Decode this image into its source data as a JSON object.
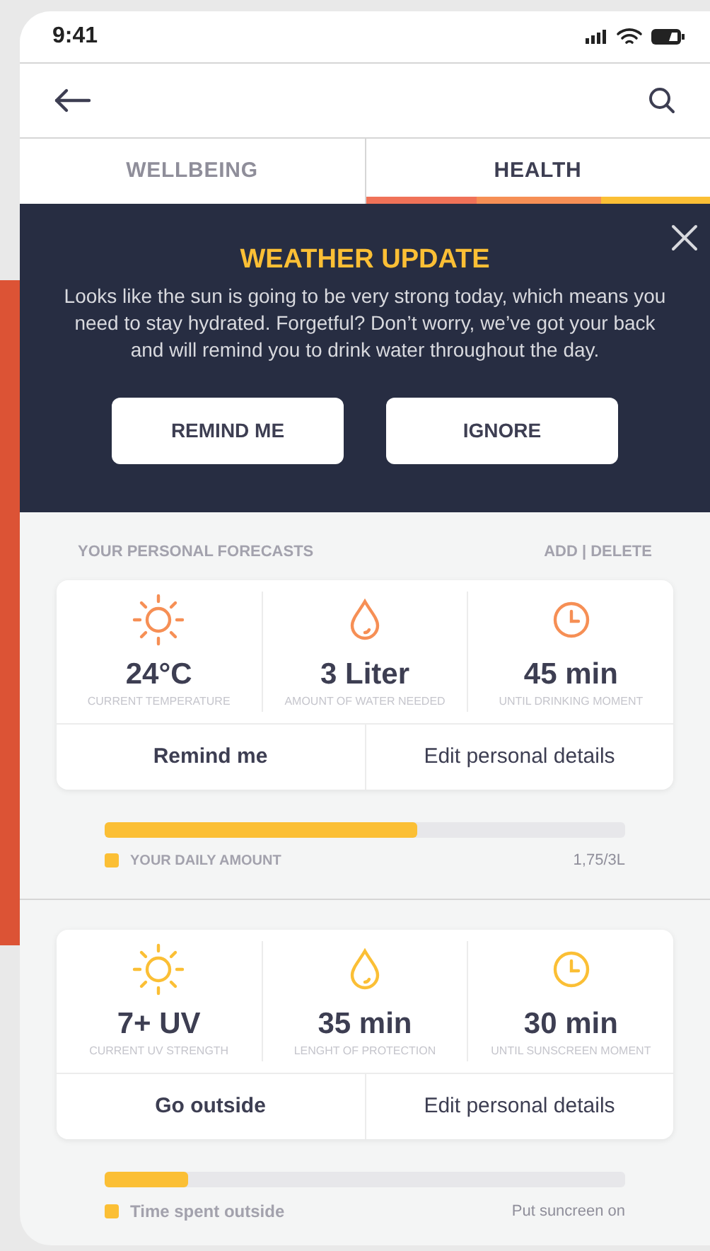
{
  "status_bar": {
    "time": "9:41"
  },
  "tabs": [
    {
      "label": "WELLBEING",
      "selected": false
    },
    {
      "label": "HEALTH",
      "selected": true
    }
  ],
  "banner": {
    "title": "WEATHER UPDATE",
    "message": "Looks like the sun is going to be very strong today, which means you need to stay hydrated. Forgetful? Don’t worry, we’ve got your back and will remind you to drink water throughout the day.",
    "buttons": [
      "REMIND ME",
      "IGNORE"
    ]
  },
  "section": {
    "title": "YOUR PERSONAL FORECASTS",
    "actions": "ADD | DELETE"
  },
  "forecasts": [
    {
      "color": "#f68f55",
      "stats": [
        {
          "kind": "sun",
          "value": "24°C",
          "caption": "CURRENT TEMPERATURE"
        },
        {
          "kind": "drop",
          "value": "3 Liter",
          "caption": "AMOUNT OF WATER NEEDED"
        },
        {
          "kind": "clock",
          "value": "45 min",
          "caption": "UNTIL DRINKING MOMENT"
        }
      ],
      "actions": [
        "Remind me",
        "Edit personal details"
      ],
      "progress": {
        "level": 0.6,
        "label": "YOUR DAILY AMOUNT",
        "reading": "1,75/3L"
      }
    },
    {
      "color": "#fbbf35",
      "stats": [
        {
          "kind": "sun",
          "value": "7+ UV",
          "caption": "CURRENT UV STRENGTH"
        },
        {
          "kind": "drop",
          "value": "35 min",
          "caption": "LENGHT OF PROTECTION"
        },
        {
          "kind": "clock",
          "value": "30 min",
          "caption": "UNTIL SUNSCREEN MOMENT"
        }
      ],
      "actions": [
        "Go outside",
        "Edit personal details"
      ],
      "progress": {
        "level": 0.16,
        "label": "Time spent outside",
        "reading": "Put suncreen on"
      }
    }
  ]
}
